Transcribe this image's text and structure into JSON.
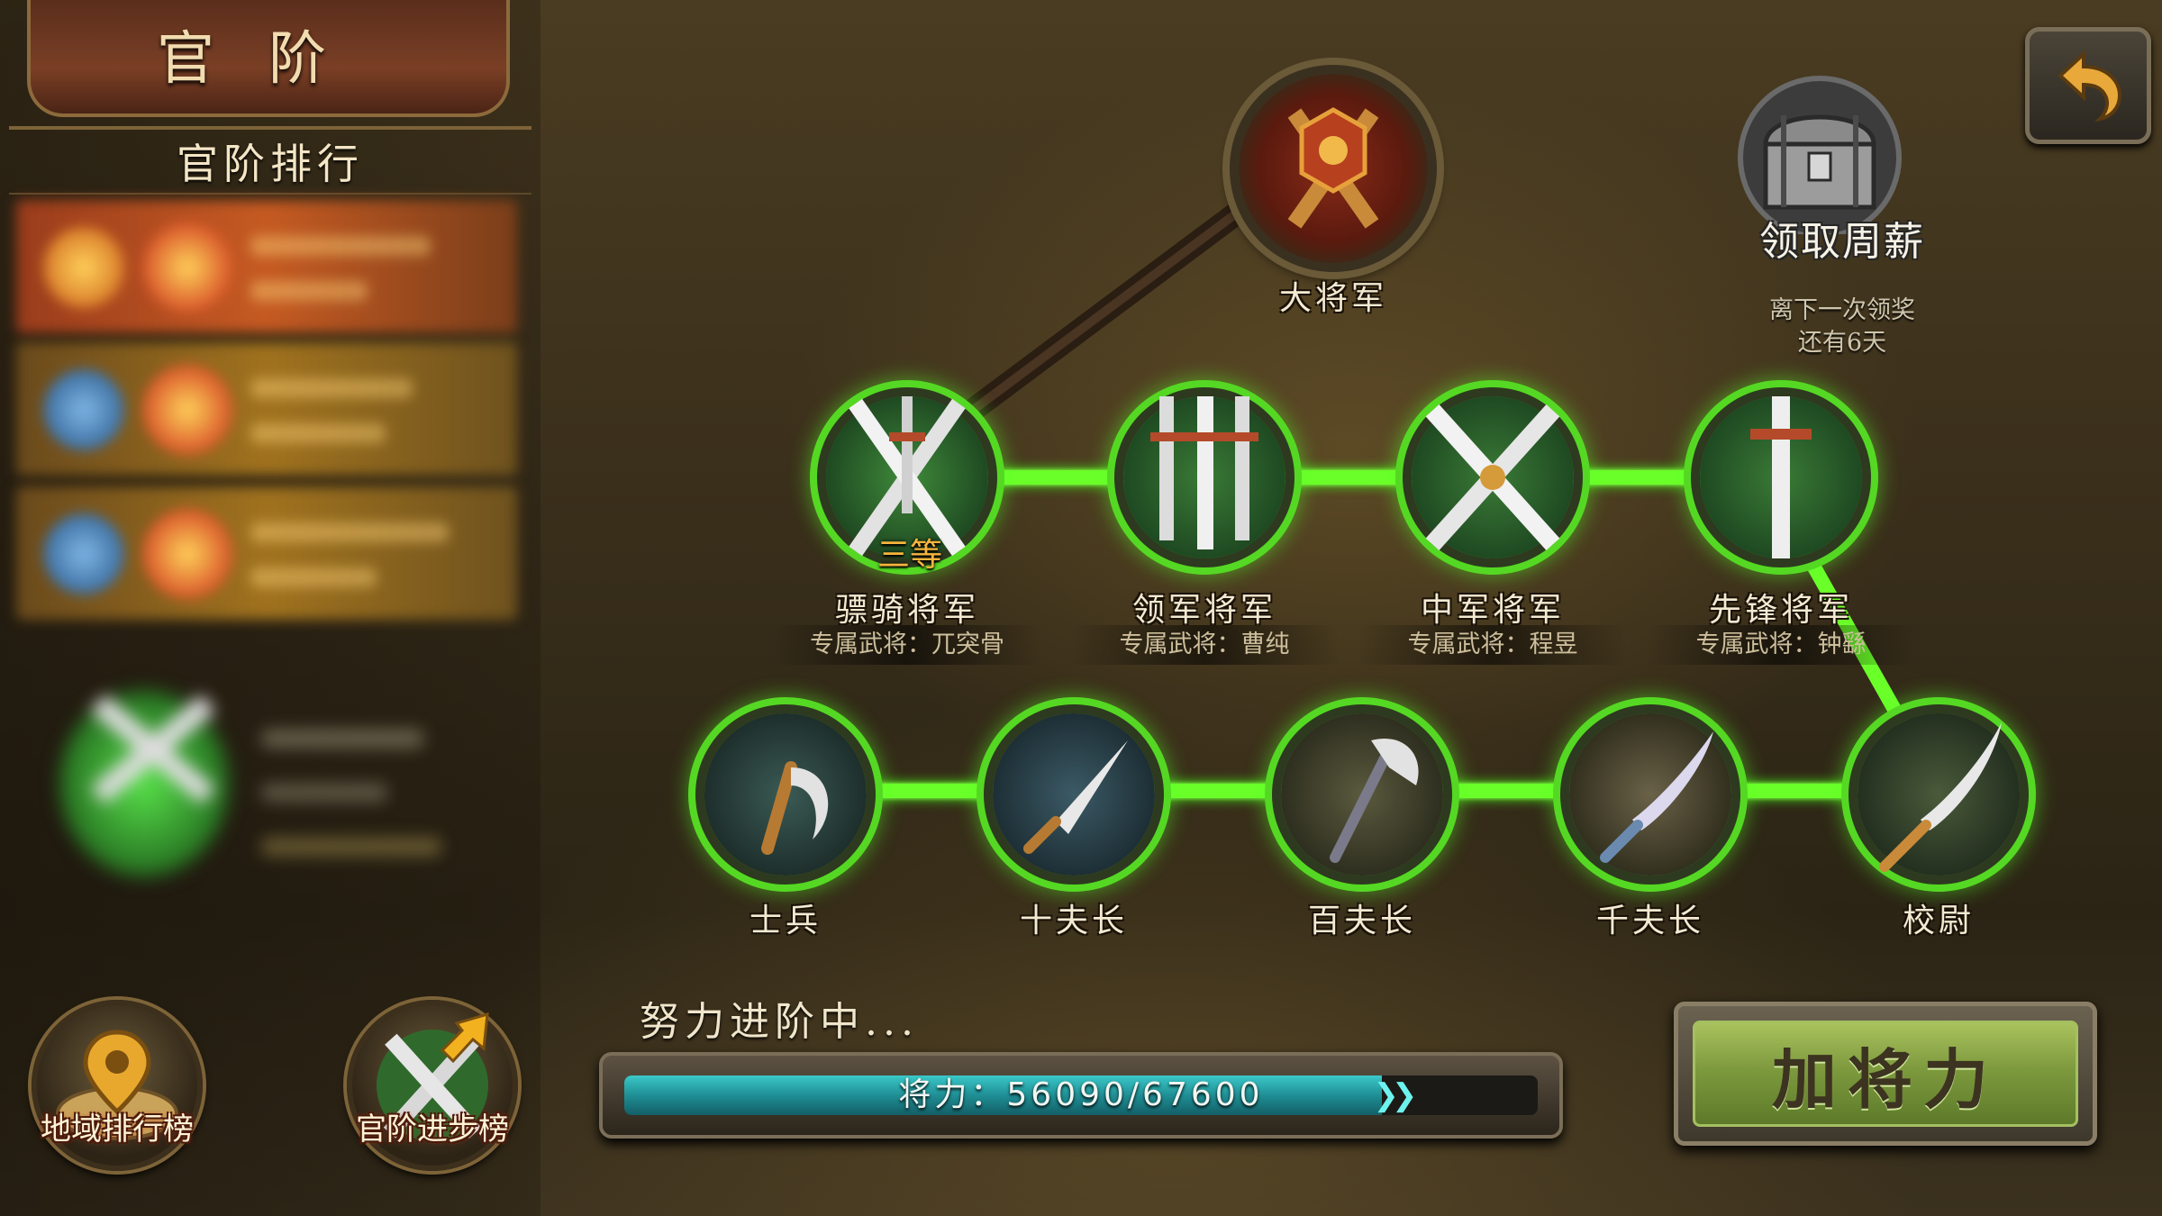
{
  "panel": {
    "title": "官阶",
    "ranking_header": "官阶排行"
  },
  "bottom_left": {
    "region_rank_label": "地域排行榜",
    "progress_rank_label": "官阶进步榜"
  },
  "salary": {
    "label": "领取周薪",
    "countdown_line1": "离下一次领奖",
    "countdown_line2": "还有6天"
  },
  "top_rank": {
    "label": "大将军"
  },
  "generals": [
    {
      "label": "骠骑将军",
      "badge": "三等",
      "note": "专属武将：兀突骨"
    },
    {
      "label": "领军将军",
      "note": "专属武将：曹纯"
    },
    {
      "label": "中军将军",
      "note": "专属武将：程昱"
    },
    {
      "label": "先锋将军",
      "note": "专属武将：钟繇"
    }
  ],
  "ranks": [
    {
      "label": "士兵"
    },
    {
      "label": "十夫长"
    },
    {
      "label": "百夫长"
    },
    {
      "label": "千夫长"
    },
    {
      "label": "校尉"
    }
  ],
  "progress": {
    "title": "努力进阶中...",
    "text": "将力：56090/67600",
    "current": 56090,
    "max": 67600
  },
  "add_power_button": "加将力",
  "colors": {
    "glow_green": "#6bff2a",
    "bar_teal": "#1f8f95",
    "button_green": "#7e9a3e"
  },
  "icons": [
    "back-arrow-icon",
    "treasure-chest-icon",
    "map-pin-icon",
    "crossed-swords-icon",
    "sword-icon",
    "dagger-icon",
    "axe-icon",
    "sickle-icon"
  ]
}
